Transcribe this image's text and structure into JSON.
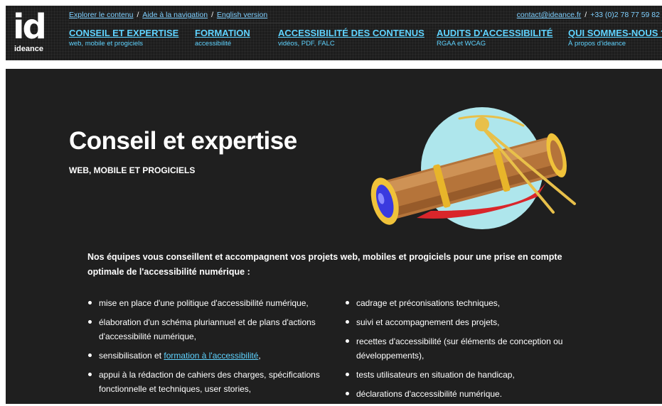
{
  "brand": {
    "logo_text": "id",
    "name": "ideance"
  },
  "topbar": {
    "links": [
      "Explorer le contenu",
      "Aide à la navigation",
      "English version"
    ],
    "separator": "/",
    "email": "contact@ideance.fr",
    "phone": "+33 (0)2 78 77 59 82"
  },
  "nav": {
    "items": [
      {
        "title": "CONSEIL ET EXPERTISE",
        "sub": "web, mobile et progiciels"
      },
      {
        "title": "FORMATION",
        "sub": "accessibilité"
      },
      {
        "title": "ACCESSIBILITÉ DES CONTENUS",
        "sub": "vidéos, PDF, FALC"
      },
      {
        "title": "AUDITS D'ACCESSIBILITÉ",
        "sub": "RGAA et WCAG"
      },
      {
        "title": "QUI SOMMES-NOUS ?",
        "sub": "À propos d'ideance"
      }
    ]
  },
  "hero": {
    "title": "Conseil et expertise",
    "subtitle": "WEB, MOBILE ET PROGICIELS"
  },
  "content": {
    "intro": "Nos équipes vous conseillent et accompagnent vos projets web, mobiles et progiciels pour une prise en compte optimale de l'accessibilité numérique :",
    "left": [
      "mise en place d'une politique d'accessibilité numérique,",
      "élaboration d'un schéma pluriannuel et de plans d'actions d'accessibilité numérique,",
      {
        "before": "sensibilisation et ",
        "link": "formation à l'accessibilité",
        "after": ","
      },
      "appui à la rédaction de cahiers des charges, spécifications fonctionnelle et techniques, user stories,"
    ],
    "right": [
      "cadrage et préconisations techniques,",
      "suivi et accompagnement des projets,",
      "recettes d'accessibilité (sur éléments de conception ou développements),",
      "tests utilisateurs en situation de handicap,",
      "déclarations d'accessibilité numérique."
    ]
  },
  "colors": {
    "header_bg": "#1d1d1d",
    "main_bg": "#1f1f1f",
    "link": "#5fd3ff",
    "illus_circle": "#aee6ec"
  }
}
